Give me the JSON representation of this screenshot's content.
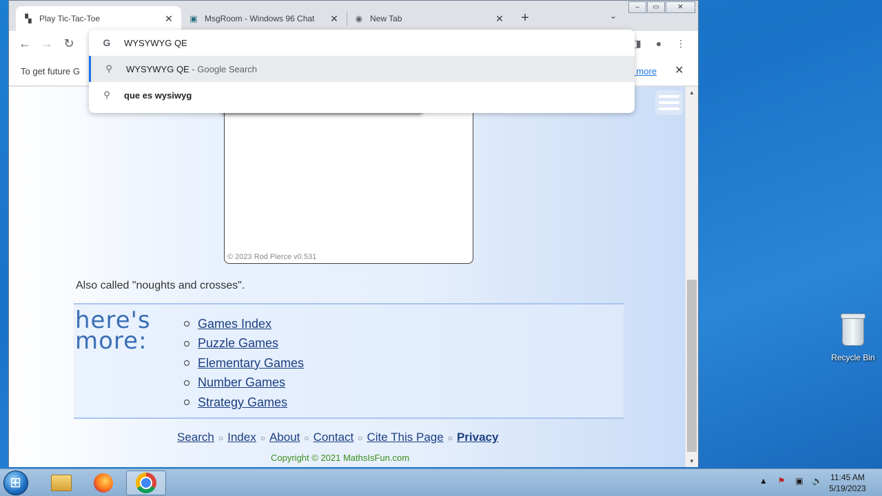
{
  "browser": {
    "tabs": [
      {
        "title": "Play Tic-Tac-Toe",
        "icon": "tic-tac-toe-favicon"
      },
      {
        "title": "MsgRoom - Windows 96 Chat",
        "icon": "msgroom-favicon"
      },
      {
        "title": "New Tab",
        "icon": "chrome-favicon"
      }
    ],
    "new_tab_symbol": "+",
    "tab_close_symbol": "✕",
    "tab_dropdown_symbol": "⌄",
    "window_controls": {
      "minimize": "–",
      "maximize": "▭",
      "close": "✕"
    },
    "omnibox": {
      "query": "WYSYWYG QE",
      "suggestions": [
        {
          "text": "WYSYWYG QE",
          "suffix": " - Google Search"
        },
        {
          "text": "que es wysiwyg",
          "suffix": ""
        }
      ]
    },
    "infobar": {
      "message": "To get future G",
      "link": "arn more",
      "close": "✕"
    }
  },
  "page": {
    "game_copyright": "© 2023 Rod Pierce v0.531",
    "also_called": "Also called \"noughts and crosses\".",
    "more_logo": "here's more:",
    "more_links": [
      "Games Index",
      "Puzzle Games",
      "Elementary Games",
      "Number Games",
      "Strategy Games"
    ],
    "footer_links": [
      "Search",
      "Index",
      "About",
      "Contact",
      "Cite This Page"
    ],
    "privacy": "Privacy",
    "copyright": "Copyright © 2021 MathsIsFun.com"
  },
  "desktop": {
    "recycle_bin": "Recycle Bin"
  },
  "taskbar": {
    "time": "11:45 AM",
    "date": "5/19/2023"
  },
  "colors": {
    "accent": "#1a73e8",
    "link": "#1c3f80",
    "copyright_green": "#3a8f1a"
  }
}
